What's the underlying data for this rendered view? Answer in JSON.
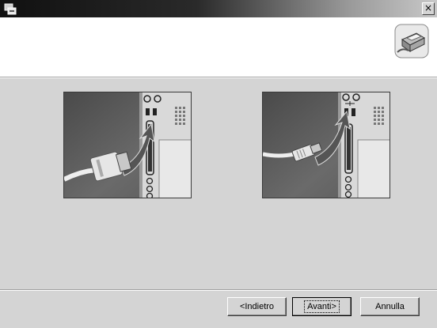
{
  "titlebar": {
    "close_label": "×",
    "app_icon": "installer-icon"
  },
  "header": {
    "printer_icon": "printer-icon"
  },
  "illustrations": [
    {
      "name": "parallel-cable-illustration"
    },
    {
      "name": "usb-cable-illustration"
    }
  ],
  "buttons": {
    "back_label": "<Indietro",
    "next_label": "Avanti>",
    "cancel_label": "Annulla"
  }
}
